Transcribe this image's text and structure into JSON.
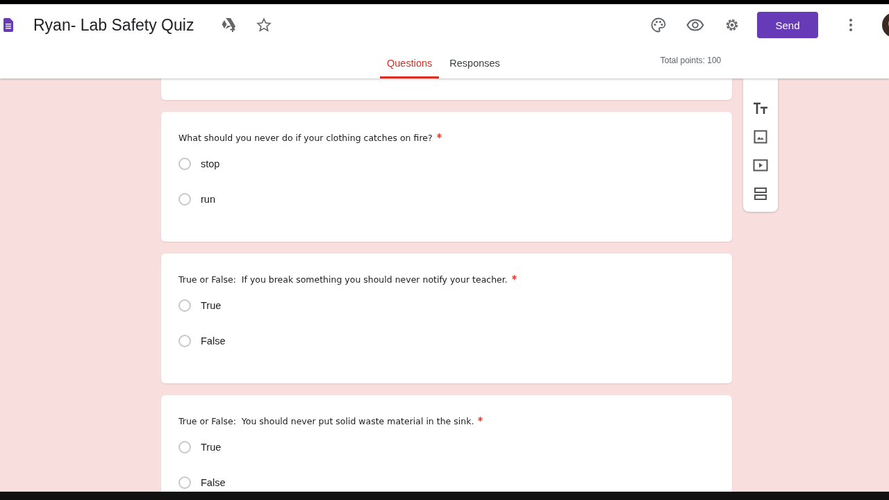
{
  "header": {
    "title": "Ryan- Lab Safety Quiz",
    "send_label": "Send",
    "tabs": [
      {
        "label": "Questions",
        "selected": true
      },
      {
        "label": "Responses",
        "selected": false
      }
    ],
    "total_points": "Total points: 100"
  },
  "questions": [
    {
      "text": "What should you never do if your clothing catches on fire?",
      "required": true,
      "options": [
        {
          "label": "stop",
          "selected": false
        },
        {
          "label": "run",
          "selected": false
        }
      ]
    },
    {
      "text": "True or False:  If you break something you should never notify your teacher.",
      "required": true,
      "options": [
        {
          "label": "True",
          "selected": false
        },
        {
          "label": "False",
          "selected": false
        }
      ]
    },
    {
      "text": "True or False:  You should never put solid waste material in the sink.",
      "required": true,
      "options": [
        {
          "label": "True",
          "selected": false
        },
        {
          "label": "False",
          "selected": false
        }
      ]
    }
  ]
}
